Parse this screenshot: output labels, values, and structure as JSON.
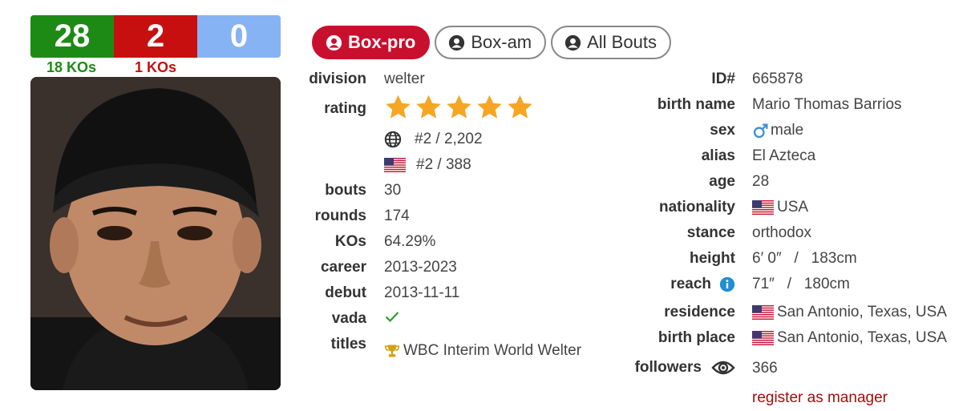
{
  "record": {
    "wins": "28",
    "losses": "2",
    "draws": "0",
    "win_kos": "18 KOs",
    "loss_kos": "1 KOs"
  },
  "tabs": [
    {
      "label": "Box-pro",
      "active": true
    },
    {
      "label": "Box-am",
      "active": false
    },
    {
      "label": "All Bouts",
      "active": false
    }
  ],
  "left": {
    "division_label": "division",
    "division": "welter",
    "rating_label": "rating",
    "rating_stars": 5,
    "world_rank": "#2 / 2,202",
    "country_rank": "#2 / 388",
    "bouts_label": "bouts",
    "bouts": "30",
    "rounds_label": "rounds",
    "rounds": "174",
    "kos_label": "KOs",
    "kos": "64.29%",
    "career_label": "career",
    "career": "2013-2023",
    "debut_label": "debut",
    "debut": "2013-11-11",
    "vada_label": "vada",
    "titles_label": "titles",
    "title": "WBC Interim World Welter"
  },
  "right": {
    "id_label": "ID#",
    "id": "665878",
    "birth_name_label": "birth name",
    "birth_name": "Mario Thomas Barrios",
    "sex_label": "sex",
    "sex": "male",
    "alias_label": "alias",
    "alias": "El Azteca",
    "age_label": "age",
    "age": "28",
    "nationality_label": "nationality",
    "nationality": "USA",
    "stance_label": "stance",
    "stance": "orthodox",
    "height_label": "height",
    "height": "6′ 0″   /   183cm",
    "reach_label": "reach",
    "reach": "71″   /   180cm",
    "residence_label": "residence",
    "residence": "San Antonio, Texas, USA",
    "birth_place_label": "birth place",
    "birth_place": "San Antonio, Texas, USA",
    "followers_label": "followers",
    "followers": "366",
    "register": "register as manager"
  },
  "colors": {
    "win": "#1e8a16",
    "loss": "#c80f0f",
    "draw": "#86b3f3",
    "accent": "#c8102e",
    "star": "#f5a623"
  }
}
